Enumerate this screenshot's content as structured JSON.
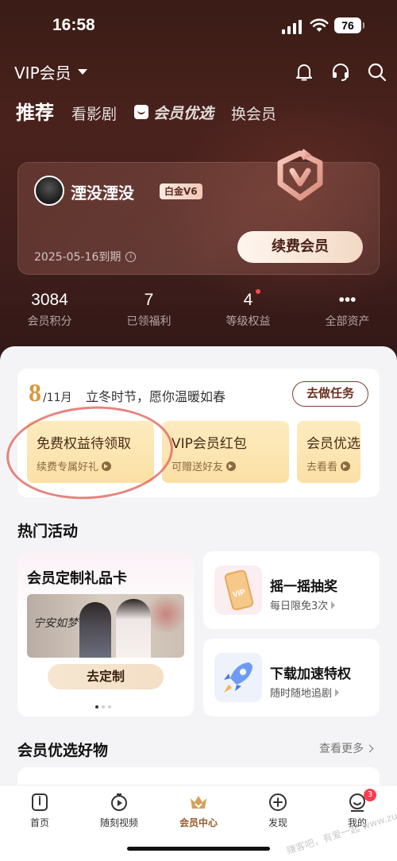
{
  "status_bar": {
    "time": "16:58",
    "battery": "76"
  },
  "header": {
    "vip_select": "VIP会员",
    "tabs": [
      {
        "label": "推荐"
      },
      {
        "label": "看影剧"
      },
      {
        "label": "会员优选"
      },
      {
        "label": "换会员"
      }
    ]
  },
  "member": {
    "username": "湮没湮没",
    "level": "白金V6",
    "expire": "2025-05-16到期",
    "renew_label": "续费会员"
  },
  "stats": [
    {
      "value": "3084",
      "label": "会员积分"
    },
    {
      "value": "7",
      "label": "已领福利"
    },
    {
      "value": "4",
      "label": "等级权益"
    },
    {
      "value": "•••",
      "label": "全部资产"
    }
  ],
  "task": {
    "day": "8",
    "month": "/11月",
    "greeting": "立冬时节，愿你温暖如春",
    "button": "去做任务",
    "benefits": [
      {
        "title": "免费权益待领取",
        "sub": "续费专属好礼"
      },
      {
        "title": "VIP会员红包",
        "sub": "可赠送好友"
      },
      {
        "title": "会员优选",
        "sub": "去看看"
      }
    ]
  },
  "hot": {
    "title": "热门活动",
    "gift_card": {
      "title": "会员定制礼品卡",
      "poster_caption": "宁安如梦",
      "button": "去定制"
    },
    "activities": [
      {
        "title": "摇一摇抽奖",
        "sub": "每日限免3次"
      },
      {
        "title": "下载加速特权",
        "sub": "随时随地追剧"
      }
    ]
  },
  "goods": {
    "title": "会员优选好物",
    "more": "查看更多"
  },
  "tabbar": [
    {
      "label": "首页"
    },
    {
      "label": "随刻视频"
    },
    {
      "label": "会员中心"
    },
    {
      "label": "发现"
    },
    {
      "label": "我的",
      "badge": "3"
    }
  ],
  "watermark": "赚客吧，有爱一起 www.zuanke8.com",
  "colors": {
    "accent": "#d69a3c",
    "hero_bg": "#4a221d",
    "badge_red": "#ff3b4d"
  }
}
